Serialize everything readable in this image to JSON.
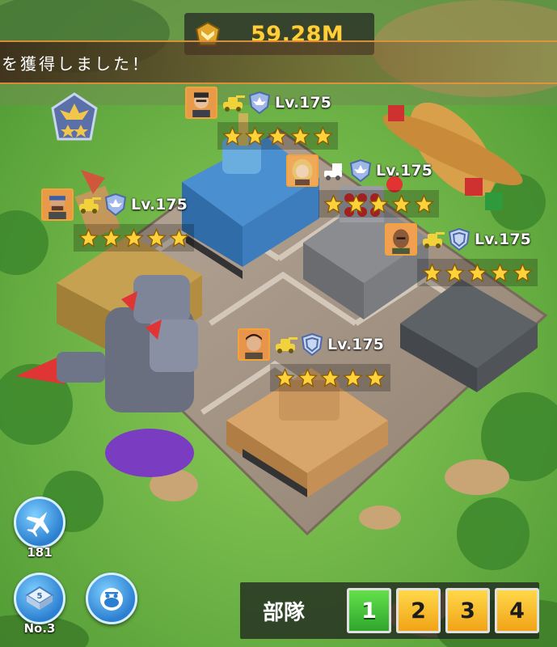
{
  "header": {
    "power_value": "59.28M",
    "notice_text": "を獲得しました！"
  },
  "units": [
    {
      "id": "hero-1",
      "level": "Lv.175",
      "stars": 5
    },
    {
      "id": "hero-2",
      "level": "Lv.175",
      "stars": 5
    },
    {
      "id": "hero-3",
      "level": "Lv.175",
      "stars": 5
    },
    {
      "id": "hero-4",
      "level": "Lv.175",
      "stars": 5
    },
    {
      "id": "hero-5",
      "level": "Lv.175",
      "stars": 5
    }
  ],
  "side": {
    "aircraft_count": "181",
    "base_label": "No.3"
  },
  "squad": {
    "label": "部隊",
    "buttons": [
      "1",
      "2",
      "3",
      "4"
    ],
    "active": "1"
  },
  "colors": {
    "gold": "#ffcf3a",
    "grass": "#7cbc4a",
    "platform": "#a8988a",
    "active_squad": "#3fbf32",
    "idle_squad": "#f6b422"
  }
}
